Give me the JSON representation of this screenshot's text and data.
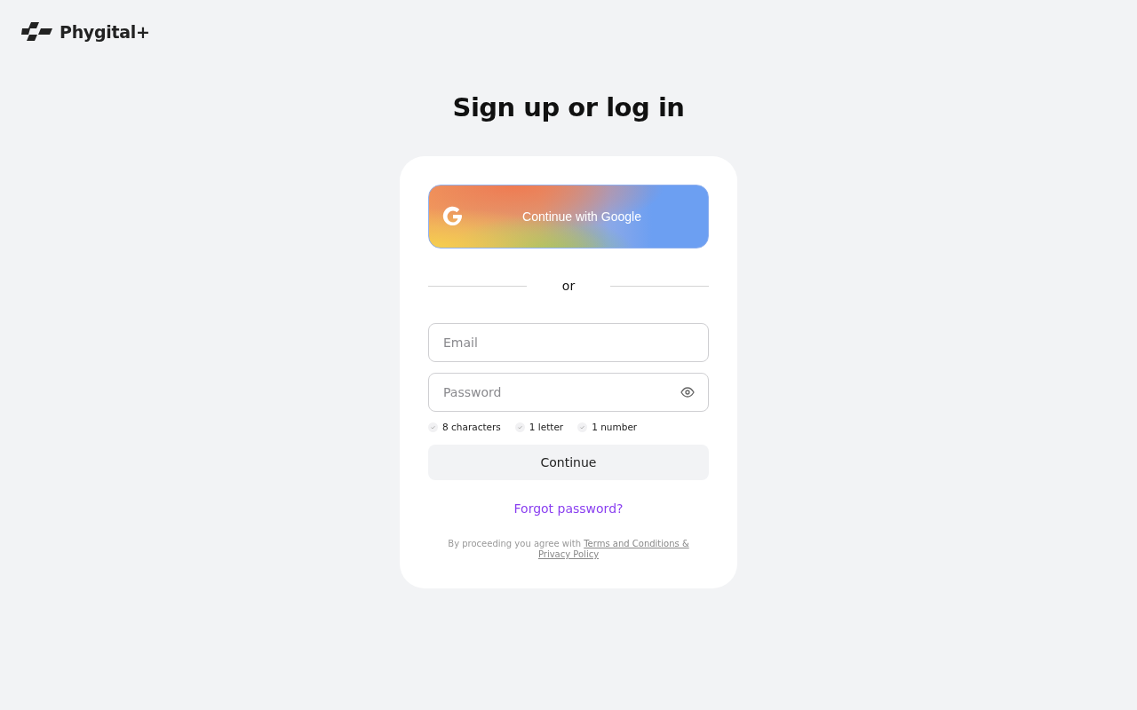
{
  "brand": {
    "name": "Phygital+"
  },
  "heading": "Sign up or log in",
  "google_button": {
    "label": "Continue with Google"
  },
  "divider": "or",
  "fields": [
    {
      "kind": "email",
      "placeholder": "Email"
    },
    {
      "kind": "password",
      "placeholder": "Password"
    }
  ],
  "requirements": [
    {
      "label": "8 characters",
      "met": false
    },
    {
      "label": "1 letter",
      "met": false
    },
    {
      "label": "1 number",
      "met": false
    }
  ],
  "continue_button": {
    "label": "Continue",
    "disabled": true
  },
  "forgot_link": "Forgot password?",
  "legal": {
    "text": "By proceeding you agree with",
    "link_parts": [
      "Terms and Conditions &",
      "Privacy Policy"
    ]
  }
}
